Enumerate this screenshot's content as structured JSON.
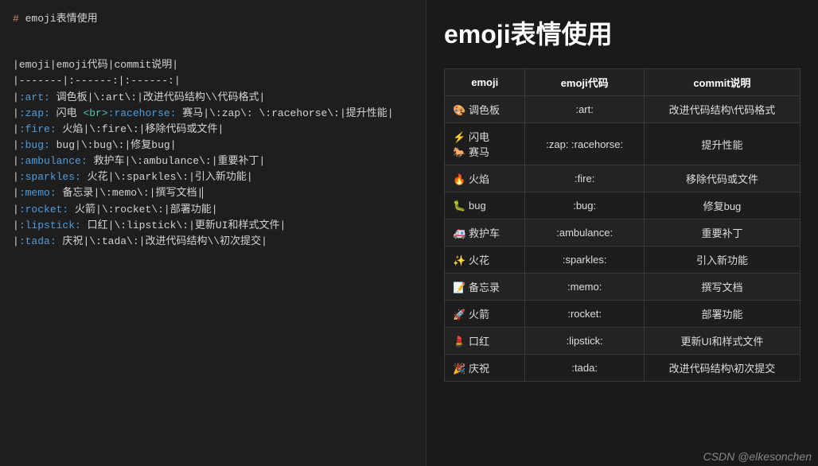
{
  "source": {
    "heading_hash": "#",
    "heading_text": "emoji表情使用",
    "lines": [
      [
        {
          "t": "punct",
          "v": "|"
        },
        {
          "t": "plain",
          "v": "emoji"
        },
        {
          "t": "punct",
          "v": "|"
        },
        {
          "t": "plain",
          "v": "emoji代码"
        },
        {
          "t": "punct",
          "v": "|"
        },
        {
          "t": "plain",
          "v": "commit说明"
        },
        {
          "t": "punct",
          "v": "|"
        }
      ],
      [
        {
          "t": "punct",
          "v": "|-------|:------:|:------:|"
        }
      ],
      [
        {
          "t": "punct",
          "v": "|"
        },
        {
          "t": "emcode",
          "v": ":art:"
        },
        {
          "t": "plain",
          "v": " 调色板"
        },
        {
          "t": "punct",
          "v": "|"
        },
        {
          "t": "plain",
          "v": "\\:art\\:"
        },
        {
          "t": "punct",
          "v": "|"
        },
        {
          "t": "plain",
          "v": "改进代码结构\\\\代码格式"
        },
        {
          "t": "punct",
          "v": "|"
        }
      ],
      [
        {
          "t": "punct",
          "v": "|"
        },
        {
          "t": "emcode",
          "v": ":zap:"
        },
        {
          "t": "plain",
          "v": " 闪电 "
        },
        {
          "t": "tag",
          "v": "<br>"
        },
        {
          "t": "emcode",
          "v": ":racehorse:"
        },
        {
          "t": "plain",
          "v": " 赛马"
        },
        {
          "t": "punct",
          "v": "|"
        },
        {
          "t": "plain",
          "v": "\\:zap\\: \\:racehorse\\:"
        },
        {
          "t": "punct",
          "v": "|"
        },
        {
          "t": "plain",
          "v": "提升性能"
        },
        {
          "t": "punct",
          "v": "|"
        }
      ],
      [
        {
          "t": "punct",
          "v": "|"
        },
        {
          "t": "emcode",
          "v": ":fire:"
        },
        {
          "t": "plain",
          "v": " 火焰"
        },
        {
          "t": "punct",
          "v": "|"
        },
        {
          "t": "plain",
          "v": "\\:fire\\:"
        },
        {
          "t": "punct",
          "v": "|"
        },
        {
          "t": "plain",
          "v": "移除代码或文件"
        },
        {
          "t": "punct",
          "v": "|"
        }
      ],
      [
        {
          "t": "punct",
          "v": "|"
        },
        {
          "t": "emcode",
          "v": ":bug:"
        },
        {
          "t": "plain",
          "v": " bug"
        },
        {
          "t": "punct",
          "v": "|"
        },
        {
          "t": "plain",
          "v": "\\:bug\\:"
        },
        {
          "t": "punct",
          "v": "|"
        },
        {
          "t": "plain",
          "v": "修复bug"
        },
        {
          "t": "punct",
          "v": "|"
        }
      ],
      [
        {
          "t": "punct",
          "v": "|"
        },
        {
          "t": "emcode",
          "v": ":ambulance:"
        },
        {
          "t": "plain",
          "v": " 救护车"
        },
        {
          "t": "punct",
          "v": "|"
        },
        {
          "t": "plain",
          "v": "\\:ambulance\\:"
        },
        {
          "t": "punct",
          "v": "|"
        },
        {
          "t": "plain",
          "v": "重要补丁"
        },
        {
          "t": "punct",
          "v": "|"
        }
      ],
      [
        {
          "t": "punct",
          "v": "|"
        },
        {
          "t": "emcode",
          "v": ":sparkles:"
        },
        {
          "t": "plain",
          "v": " 火花"
        },
        {
          "t": "punct",
          "v": "|"
        },
        {
          "t": "plain",
          "v": "\\:sparkles\\:"
        },
        {
          "t": "punct",
          "v": "|"
        },
        {
          "t": "plain",
          "v": "引入新功能"
        },
        {
          "t": "punct",
          "v": "|"
        }
      ],
      [
        {
          "t": "punct",
          "v": "|"
        },
        {
          "t": "emcode",
          "v": ":memo:"
        },
        {
          "t": "plain",
          "v": " 备忘录"
        },
        {
          "t": "punct",
          "v": "|"
        },
        {
          "t": "plain",
          "v": "\\:memo\\:"
        },
        {
          "t": "punct",
          "v": "|"
        },
        {
          "t": "plain",
          "v": "撰写文档"
        },
        {
          "t": "punct",
          "v": "|"
        },
        {
          "t": "cursor",
          "v": ""
        }
      ],
      [
        {
          "t": "punct",
          "v": "|"
        },
        {
          "t": "emcode",
          "v": ":rocket:"
        },
        {
          "t": "plain",
          "v": " 火箭"
        },
        {
          "t": "punct",
          "v": "|"
        },
        {
          "t": "plain",
          "v": "\\:rocket\\:"
        },
        {
          "t": "punct",
          "v": "|"
        },
        {
          "t": "plain",
          "v": "部署功能"
        },
        {
          "t": "punct",
          "v": "|"
        }
      ],
      [
        {
          "t": "punct",
          "v": "|"
        },
        {
          "t": "emcode",
          "v": ":lipstick:"
        },
        {
          "t": "plain",
          "v": " 口红"
        },
        {
          "t": "punct",
          "v": "|"
        },
        {
          "t": "plain",
          "v": "\\:lipstick\\:"
        },
        {
          "t": "punct",
          "v": "|"
        },
        {
          "t": "plain",
          "v": "更新UI和样式文件"
        },
        {
          "t": "punct",
          "v": "|"
        }
      ],
      [
        {
          "t": "punct",
          "v": "|"
        },
        {
          "t": "emcode",
          "v": ":tada:"
        },
        {
          "t": "plain",
          "v": " 庆祝"
        },
        {
          "t": "punct",
          "v": "|"
        },
        {
          "t": "plain",
          "v": "\\:tada\\:"
        },
        {
          "t": "punct",
          "v": "|"
        },
        {
          "t": "plain",
          "v": "改进代码结构\\\\初次提交"
        },
        {
          "t": "punct",
          "v": "|"
        }
      ]
    ]
  },
  "preview": {
    "heading": "emoji表情使用",
    "headers": [
      "emoji",
      "emoji代码",
      "commit说明"
    ],
    "rows": [
      {
        "cell1_lines": [
          {
            "icon": "🎨",
            "iconName": "art-icon",
            "text": "调色板"
          }
        ],
        "code": ":art:",
        "desc": "改进代码结构\\代码格式"
      },
      {
        "cell1_lines": [
          {
            "icon": "⚡",
            "iconName": "zap-icon",
            "text": "闪电"
          },
          {
            "icon": "🐎",
            "iconName": "racehorse-icon",
            "text": "赛马"
          }
        ],
        "code": ":zap: :racehorse:",
        "desc": "提升性能"
      },
      {
        "cell1_lines": [
          {
            "icon": "🔥",
            "iconName": "fire-icon",
            "text": "火焰"
          }
        ],
        "code": ":fire:",
        "desc": "移除代码或文件"
      },
      {
        "cell1_lines": [
          {
            "icon": "🐛",
            "iconName": "bug-icon",
            "text": "bug"
          }
        ],
        "code": ":bug:",
        "desc": "修复bug"
      },
      {
        "cell1_lines": [
          {
            "icon": "🚑",
            "iconName": "ambulance-icon",
            "text": "救护车"
          }
        ],
        "code": ":ambulance:",
        "desc": "重要补丁"
      },
      {
        "cell1_lines": [
          {
            "icon": "✨",
            "iconName": "sparkles-icon",
            "text": "火花"
          }
        ],
        "code": ":sparkles:",
        "desc": "引入新功能"
      },
      {
        "cell1_lines": [
          {
            "icon": "📝",
            "iconName": "memo-icon",
            "text": "备忘录"
          }
        ],
        "code": ":memo:",
        "desc": "撰写文档"
      },
      {
        "cell1_lines": [
          {
            "icon": "🚀",
            "iconName": "rocket-icon",
            "text": "火箭"
          }
        ],
        "code": ":rocket:",
        "desc": "部署功能"
      },
      {
        "cell1_lines": [
          {
            "icon": "💄",
            "iconName": "lipstick-icon",
            "text": "口红"
          }
        ],
        "code": ":lipstick:",
        "desc": "更新UI和样式文件"
      },
      {
        "cell1_lines": [
          {
            "icon": "🎉",
            "iconName": "tada-icon",
            "text": "庆祝"
          }
        ],
        "code": ":tada:",
        "desc": "改进代码结构\\初次提交"
      }
    ]
  },
  "watermark": "CSDN @elkesonchen"
}
